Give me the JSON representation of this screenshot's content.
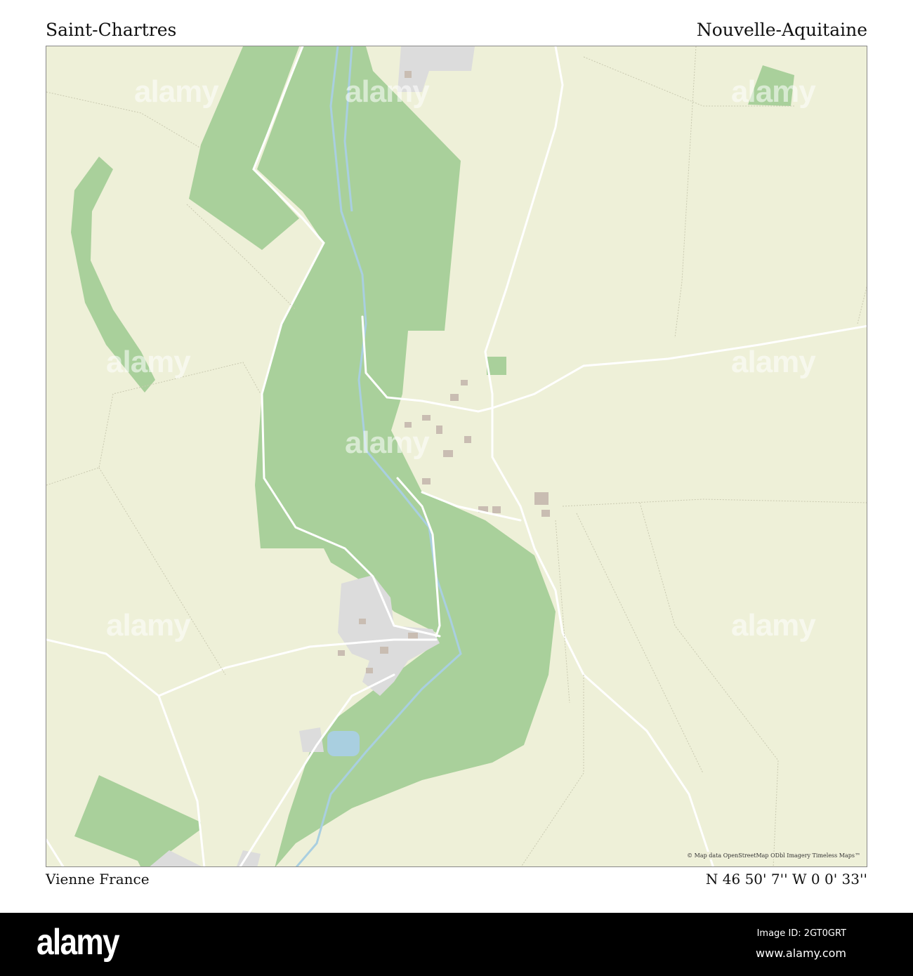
{
  "header": {
    "place": "Saint-Chartres",
    "region": "Nouvelle-Aquitaine"
  },
  "footer_info": {
    "location": "Vienne  France",
    "coordinates": "N 46 50' 7''   W 0 0' 33''"
  },
  "map": {
    "attribution": "© Map data OpenStreetMap ODbl Imagery Timeless Maps™",
    "colors": {
      "land": "#eef0d8",
      "forest": "#a9d09b",
      "road": "#ffffff",
      "water": "#a9cfe0",
      "building": "#c9c0b8",
      "residential": "#dcdcdc"
    }
  },
  "watermark": "alamy",
  "stock_footer": {
    "logo": "alamy",
    "image_id": "Image ID: 2GT0GRT",
    "url": "www.alamy.com"
  }
}
